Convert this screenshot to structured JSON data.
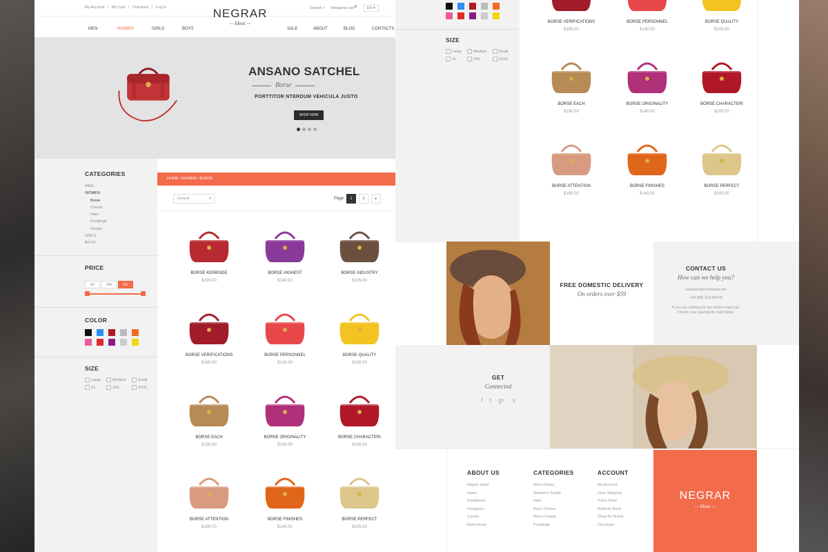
{
  "colors": {
    "accent": "#f26b4a",
    "dark": "#2a2a2a",
    "sidebar_bg": "#f2f2f2"
  },
  "top": {
    "links": [
      "My Account",
      "/",
      "My Cart",
      "/",
      "Checkout",
      "/",
      "Log In"
    ],
    "search": "Search",
    "cart": "Shopping cart",
    "lang": "EN"
  },
  "logo": {
    "name": "NEGRAR",
    "sub": "Ideas"
  },
  "nav": {
    "items": [
      "MEN",
      "WOMEN",
      "GIRLS",
      "BOYS",
      "SALE",
      "ABOUT",
      "BLOG",
      "CONTACTS"
    ]
  },
  "hero": {
    "title": "ANSANO SATCHEL",
    "sub": "Borse",
    "tag": "PORTTITOR NTERDUM VEHICULA JUSTO",
    "button": "SHOP NOW"
  },
  "sidebar": {
    "categories_title": "CATEGORIES",
    "categories": [
      {
        "label": "MEN"
      },
      {
        "label": "WOMEN"
      },
      {
        "label": "Borse"
      },
      {
        "label": "Cinture"
      },
      {
        "label": "Hats"
      },
      {
        "label": "Portafogli"
      },
      {
        "label": "Scarpe"
      },
      {
        "label": "GIRLS"
      },
      {
        "label": "BOYS"
      }
    ],
    "price_title": "PRICE",
    "price_min": "50",
    "price_max": "500",
    "price_go": "GO",
    "price_range": {
      "min_fraction": 0,
      "max_fraction": 1
    },
    "color_title": "COLOR",
    "colors": [
      "#111111",
      "#2d8ff0",
      "#b01c22",
      "#bbbbbb",
      "#f26b21",
      "#ee5a9e",
      "#e02a2a",
      "#8b1a8b",
      "#cccccc",
      "#f5d50f"
    ],
    "size_title": "SIZE",
    "sizes": [
      "Large",
      "Medium",
      "Small",
      "XL",
      "XXL",
      "XXXL"
    ]
  },
  "breadcrumb": "HOME / WOMEN / BORSE",
  "filters": {
    "sort": "Default",
    "page_label": "Page",
    "pages": [
      "1",
      "2"
    ],
    "next": "▸"
  },
  "products": [
    {
      "name": "BORSE KERBSIDE",
      "price": "$190.00",
      "color": "#b82a30"
    },
    {
      "name": "BORSE HIGHEST",
      "price": "$140.00",
      "color": "#8a3a9a"
    },
    {
      "name": "BORSE INDUSTRY",
      "price": "$105.00",
      "color": "#6b5040"
    },
    {
      "name": "BORSE VERIFICATIONS",
      "price": "$190.00",
      "color": "#a01c2a"
    },
    {
      "name": "BORSE PERSONNEL",
      "price": "$140.00",
      "color": "#e8474a"
    },
    {
      "name": "BORSE QUALITY",
      "price": "$105.00",
      "color": "#f3c322"
    },
    {
      "name": "BORSE EACH",
      "price": "$190.00",
      "color": "#b88a55"
    },
    {
      "name": "BORSE ORIGINALITY",
      "price": "$140.00",
      "color": "#b0307a"
    },
    {
      "name": "BORSE CHARACTERI",
      "price": "$105.00",
      "color": "#b01828"
    },
    {
      "name": "BORSE ATTENTION",
      "price": "$190.00",
      "color": "#d89a80"
    },
    {
      "name": "BORSE FINISHES",
      "price": "$140.00",
      "color": "#e0661a"
    },
    {
      "name": "BORSE PERFECT",
      "price": "$105.00",
      "color": "#dcc68a"
    }
  ],
  "promo": {
    "delivery_title": "FREE DOMESTIC DELIVERY",
    "delivery_sub": "On orders over $59",
    "contact_title": "CONTACT US",
    "contact_sub": "How can we help you?",
    "contact_email": "sakahan@cmsideas.net",
    "contact_phone": "+00 800 123-45678",
    "contact_note1": "If you are waiting for our email response,",
    "contact_note2": "Check your spam/junk mail folder.",
    "get_title": "GET",
    "get_sub": "Connected",
    "social": [
      "f",
      "t",
      "g+",
      "s"
    ]
  },
  "footer": {
    "about_title": "ABOUT US",
    "about": [
      "Negrar ideas",
      "News",
      "Exhibitions",
      "Designers",
      "Career",
      "References"
    ],
    "cat_title": "CATEGORIES",
    "cats": [
      "Men's Borse",
      "Women's Scarfe",
      "Hats",
      "Boy's Cinture",
      "Men's Scarpe",
      "Portafogli"
    ],
    "acct_title": "ACCOUNT",
    "acct": [
      "My Account",
      "View Shipping",
      "Track Order",
      "Address Book",
      "Shop By Brand",
      "Checkout"
    ]
  }
}
